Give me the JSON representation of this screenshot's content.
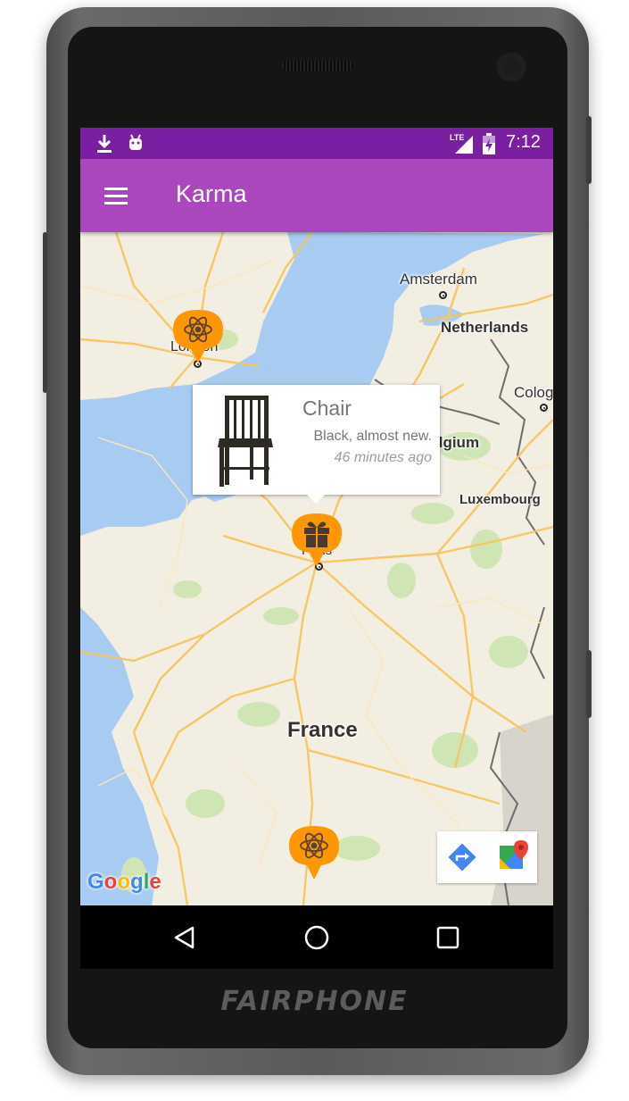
{
  "device": {
    "brand": "FAIRPHONE"
  },
  "status_bar": {
    "time": "7:12",
    "network": "LTE",
    "left_icons": [
      "download-icon",
      "android-icon"
    ],
    "right_icons": [
      "signal-icon",
      "battery-icon"
    ]
  },
  "app_bar": {
    "title": "Karma",
    "menu_icon": "hamburger-menu-icon",
    "color": "#ab47bc",
    "status_color": "#7b1fa2"
  },
  "map": {
    "labels": {
      "amsterdam": "Amsterdam",
      "netherlands": "Netherlands",
      "london": "London",
      "cologne": "Cologne",
      "luxembourg": "Luxembourg",
      "belgium": "Belgium",
      "paris": "Paris",
      "france": "France"
    },
    "attribution": "Google",
    "pins": [
      {
        "icon": "atom-icon",
        "near": "London"
      },
      {
        "icon": "gift-icon",
        "near": "Paris"
      },
      {
        "icon": "atom-icon",
        "near": "south France"
      }
    ],
    "pin_color": "#ff9800",
    "toolbar": [
      "directions-icon",
      "google-maps-icon"
    ]
  },
  "info_window": {
    "title": "Chair",
    "description": "Black, almost new.",
    "time": "46 minutes ago",
    "image": "chair-image"
  },
  "nav_bar": {
    "buttons": [
      "back-icon",
      "home-icon",
      "recents-icon"
    ]
  }
}
